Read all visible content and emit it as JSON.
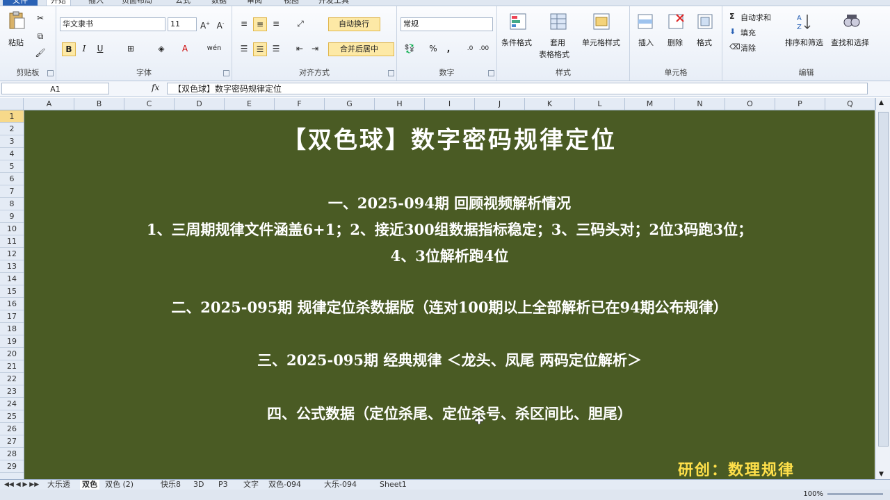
{
  "ribbon_tabs": [
    {
      "label": "文件",
      "active": false
    },
    {
      "label": "开始",
      "active": true
    },
    {
      "label": "插入",
      "active": false
    },
    {
      "label": "页面布局",
      "active": false
    },
    {
      "label": "公式",
      "active": false
    },
    {
      "label": "数据",
      "active": false
    },
    {
      "label": "审阅",
      "active": false
    },
    {
      "label": "视图",
      "active": false
    },
    {
      "label": "开发工具",
      "active": false
    }
  ],
  "clipboard": {
    "paste_label": "粘贴",
    "group_label": "剪贴板"
  },
  "font": {
    "font_name": "华文隶书",
    "font_size": "11",
    "group_label": "字体",
    "bold": "B",
    "italic": "I",
    "underline": "U"
  },
  "alignment": {
    "wrap_label": "自动换行",
    "merge_label": "合并后居中",
    "group_label": "对齐方式"
  },
  "number": {
    "format": "常规",
    "group_label": "数字",
    "percent": "%",
    "comma": ","
  },
  "styles": {
    "conditional_label": "条件格式",
    "table_label_1": "套用",
    "table_label_2": "表格格式",
    "cell_style_label": "单元格样式",
    "group_label": "样式"
  },
  "cells": {
    "insert_label": "插入",
    "delete_label": "删除",
    "format_label": "格式",
    "group_label": "单元格"
  },
  "editing": {
    "autosum_label": "自动求和",
    "fill_label": "填充",
    "clear_label": "清除",
    "sort_label": "排序和筛选",
    "find_label": "查找和选择",
    "group_label": "编辑",
    "sigma": "Σ"
  },
  "formula_bar": {
    "name_box": "A1",
    "fx": "fx",
    "content": "【双色球】数字密码规律定位"
  },
  "columns": [
    "A",
    "B",
    "C",
    "D",
    "E",
    "F",
    "G",
    "H",
    "I",
    "J",
    "K",
    "L",
    "M",
    "N",
    "O",
    "P",
    "Q"
  ],
  "rows": [
    "1",
    "2",
    "3",
    "4",
    "5",
    "6",
    "7",
    "8",
    "9",
    "10",
    "11",
    "12",
    "13",
    "14",
    "15",
    "16",
    "17",
    "18",
    "19",
    "20",
    "21",
    "22",
    "23",
    "24",
    "25",
    "26",
    "27",
    "28",
    "29"
  ],
  "content": {
    "title": "【双色球】数字密码规律定位",
    "line1": "一、2025-094期  回顾视频解析情况",
    "line2": "1、三周期规律文件涵盖6+1；2、接近300组数据指标稳定；3、三码头对；2位3码跑3位；",
    "line3": "4、3位解析跑4位",
    "line4": "二、2025-095期 规律定位杀数据版（连对100期以上全部解析已在94期公布规律）",
    "line5": "三、2025-095期 经典规律  ＜龙头、凤尾      两码定位解析＞",
    "line6": "四、公式数据（定位杀尾、定位杀号、杀区间比、胆尾）",
    "signature": "研创：数理规律"
  },
  "sheet_tabs": [
    "大乐透",
    "双色",
    "双色 (2)",
    "快乐8",
    "3D",
    "P3",
    "文字",
    "双色-094",
    "大乐-094",
    "Sheet1"
  ],
  "active_sheet": "双色",
  "status": {
    "zoom": "100%"
  },
  "colors": {
    "sheet_bg": "#4a5b24",
    "signature": "#ffe04a",
    "accent": "#2a62b5"
  }
}
